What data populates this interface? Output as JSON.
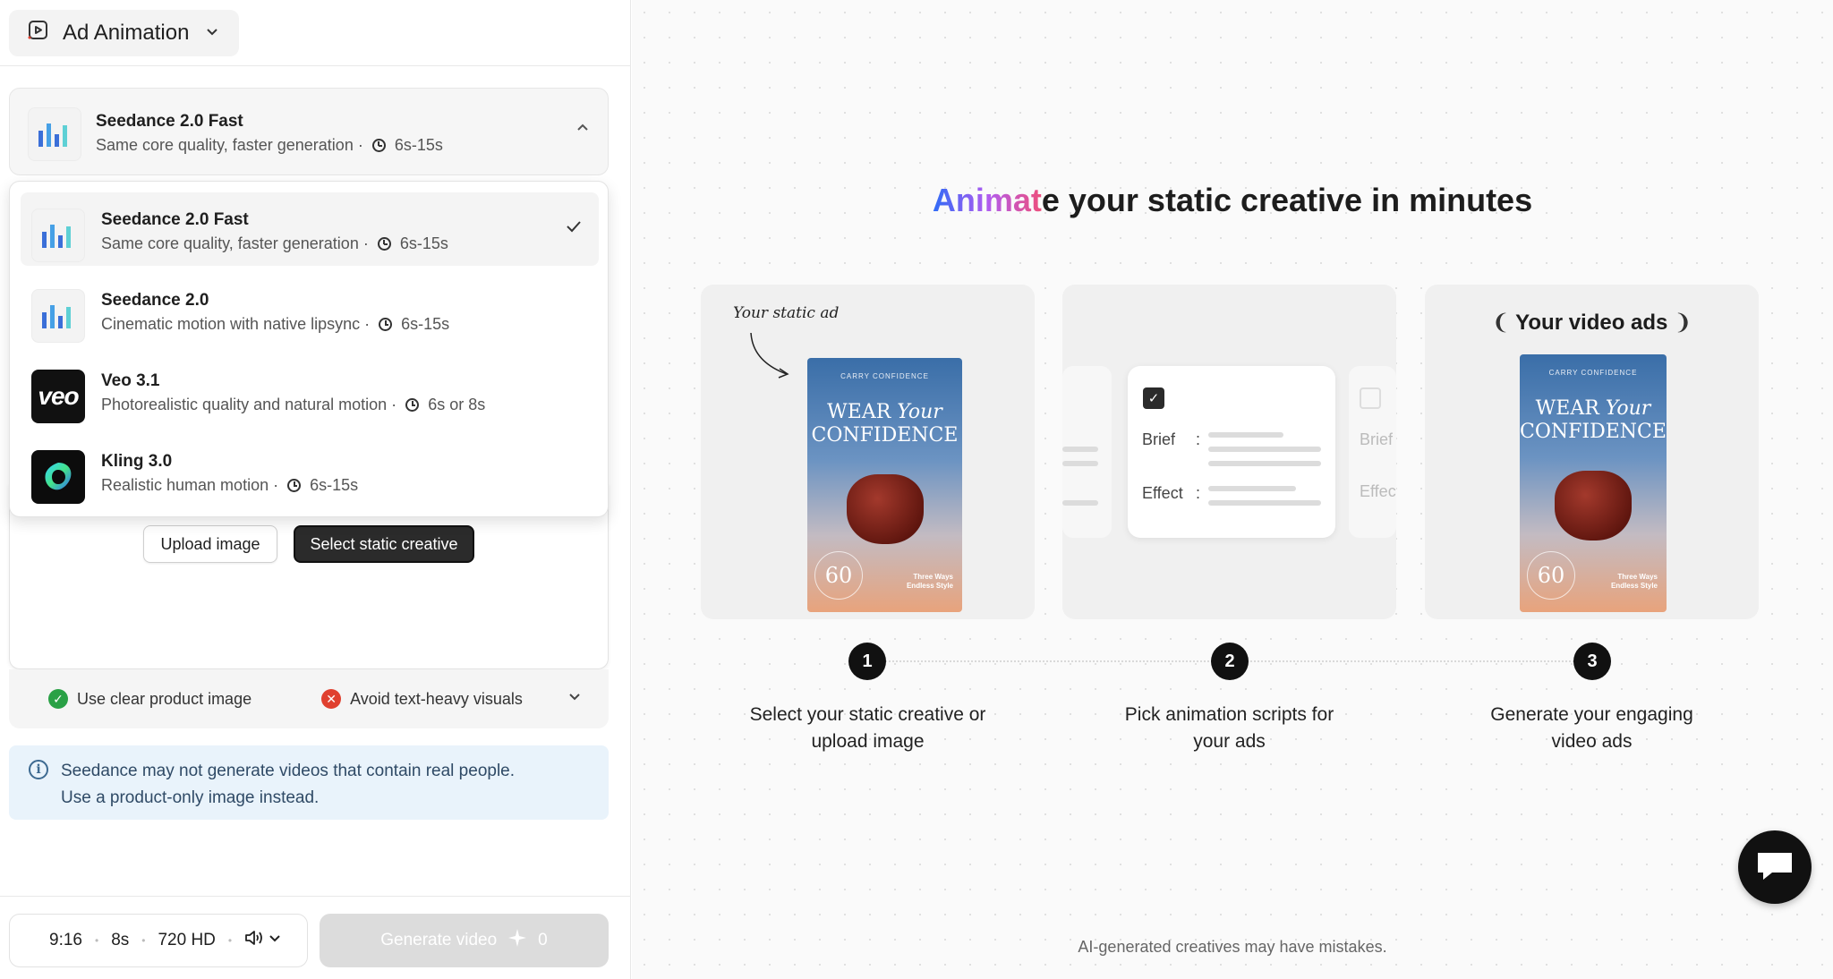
{
  "header": {
    "mode_label": "Ad Animation"
  },
  "model_select": {
    "name": "Seedance 2.0 Fast",
    "description": "Same core quality, faster generation ·",
    "duration": "6s-15s"
  },
  "dropdown": {
    "options": [
      {
        "name": "Seedance 2.0 Fast",
        "description": "Same core quality, faster generation ·",
        "duration": "6s-15s",
        "selected": true
      },
      {
        "name": "Seedance 2.0",
        "description": "Cinematic motion with native lipsync ·",
        "duration": "6s-15s",
        "selected": false
      },
      {
        "name": "Veo 3.1",
        "description": "Photorealistic quality and natural motion ·",
        "duration": "6s or 8s",
        "selected": false,
        "logo_text": "veo"
      },
      {
        "name": "Kling 3.0",
        "description": "Realistic human motion ·",
        "duration": "6s-15s",
        "selected": false
      }
    ]
  },
  "upload": {
    "upload_label": "Upload image",
    "select_label": "Select static creative"
  },
  "tips": {
    "good": "Use clear product image",
    "bad": "Avoid text-heavy visuals"
  },
  "notice": {
    "line1": "Seedance may not generate videos that contain real people.",
    "line2": "Use a product-only image instead."
  },
  "bottom": {
    "ratio": "9:16",
    "duration": "8s",
    "quality": "720 HD",
    "generate_label": "Generate video",
    "credits": "0"
  },
  "hero": {
    "headline_grad": "Animat",
    "headline_rest": "e your static creative in minutes"
  },
  "panels": {
    "p1_handwriting": "Your static ad",
    "p2_brief": "Brief",
    "p2_effect": "Effect",
    "p2_ghost_brief": "Brief",
    "p2_ghost_effect": "Effec",
    "p3_title": "Your video ads",
    "poster_brand": "CARRY CONFIDENCE",
    "poster_title_1": "WEAR",
    "poster_title_2": "Your",
    "poster_title_3": "CONFIDENCE",
    "poster_badge": "60",
    "poster_tag_1": "Three Ways",
    "poster_tag_2": "Endless Style"
  },
  "steps": [
    {
      "num": "1",
      "line1": "Select your static creative or",
      "line2": "upload image"
    },
    {
      "num": "2",
      "line1": "Pick animation scripts for",
      "line2": "your ads"
    },
    {
      "num": "3",
      "line1": "Generate your engaging",
      "line2": "video ads"
    }
  ],
  "footnote": "AI-generated creatives may have mistakes.",
  "colors": {
    "accent_dark": "#2b2b2b",
    "ok_green": "#2aa146",
    "error_red": "#e0402f",
    "notice_bg": "#e9f3fb",
    "gradient_start": "#2f6cf6",
    "gradient_end": "#ee4f7c"
  }
}
